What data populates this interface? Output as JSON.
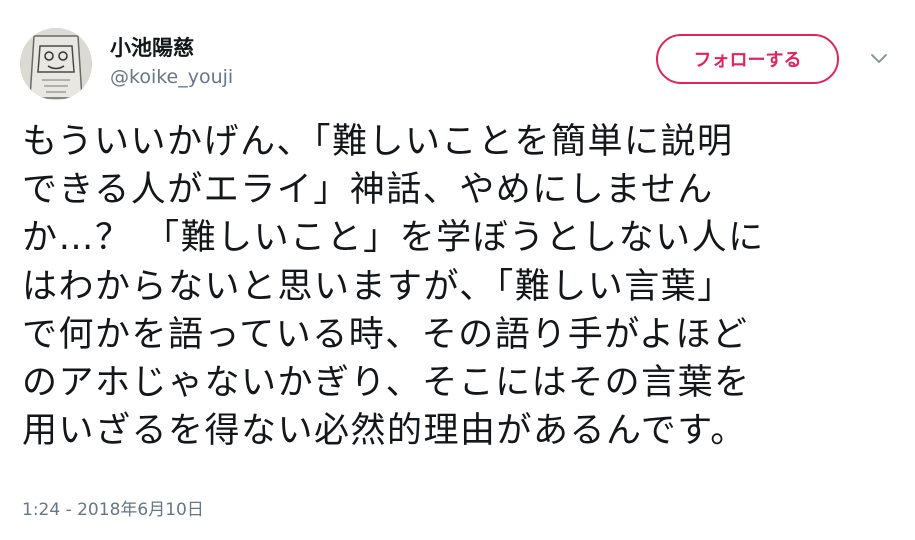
{
  "author": {
    "display_name": "小池陽慈",
    "handle": "@koike_youji",
    "avatar_icon": "avatar-portrait-icon"
  },
  "actions": {
    "follow_label": "フォローする",
    "more_icon": "chevron-down-icon"
  },
  "tweet": {
    "lines": [
      "もういいかげん、「難しいことを簡単に説明",
      "できる人がエライ」神話、やめにしません",
      "か…？ 「難しいこと」を学ぼうとしない人に",
      "はわからないと思いますが、「難しい言葉」",
      "で何かを語っている時、その語り手がよほど",
      "のアホじゃないかぎり、そこにはその言葉を",
      "用いざるを得ない必然的理由があるんです。"
    ],
    "timestamp": "1:24 - 2018年6月10日"
  },
  "colors": {
    "accent": "#e0245e",
    "text": "#14171a",
    "secondary": "#657786"
  }
}
